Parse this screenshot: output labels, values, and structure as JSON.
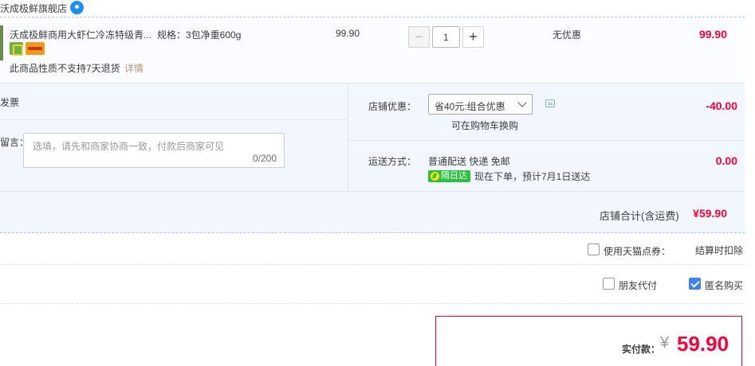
{
  "shop": {
    "name": "沃成极鲜旗舰店"
  },
  "item": {
    "title": "沃成极鲜商用大虾仁冷冻特级青...",
    "spec": "规格：3包净重600g",
    "return_note": "此商品性质不支持7天退货",
    "return_link": "详情",
    "unit_price": "99.90",
    "quantity": "1",
    "discount": "无优惠",
    "subtotal": "99.90"
  },
  "order": {
    "invoice_label": "发票",
    "message_label": "留言：",
    "message_placeholder": "选填，请先和商家协商一致，付款后商家可见",
    "message_counter": "0/200",
    "shop_promo_label": "店铺优惠：",
    "shop_promo_selected": "省40元:组合优惠",
    "shop_promo_note": "可在购物车换购",
    "shop_promo_amount": "-40.00",
    "shipping_label": "运送方式：",
    "shipping_method": "普通配送 快递 免邮",
    "nextday_badge": "隔日达",
    "delivery_estimate": "现在下单，预计7月1日送达",
    "shipping_fee": "0.00",
    "shop_total_label": "店铺合计(含运费)",
    "shop_total_value": "¥59.90"
  },
  "options": {
    "points_label": "使用天猫点券：",
    "points_note": "结算时扣除",
    "friend_pay_label": "朋友代付",
    "anonymous_label": "匿名购买",
    "anonymous_checked": true
  },
  "payment": {
    "label": "实付款：",
    "currency": "¥",
    "amount": "59.90"
  },
  "colors": {
    "price_red": "#ff0036",
    "panel_blue": "#f2f7ff",
    "checkbox_blue": "#3b82f6",
    "nextday_green": "#2bc13e"
  }
}
